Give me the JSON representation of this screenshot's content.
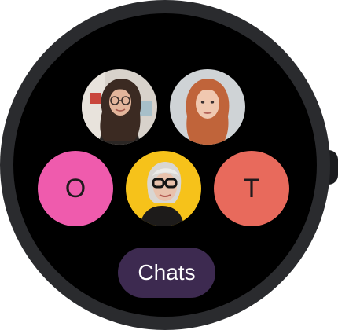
{
  "contacts": [
    {
      "type": "photo",
      "icon": "person-avatar-curly-hair-glasses"
    },
    {
      "type": "photo",
      "icon": "person-avatar-red-hair"
    },
    {
      "type": "letter",
      "initial": "O",
      "color": "#ef5bad"
    },
    {
      "type": "photo",
      "icon": "person-avatar-grey-hair-glasses"
    },
    {
      "type": "letter",
      "initial": "T",
      "color": "#e86a5c"
    }
  ],
  "chats_button": {
    "label": "Chats",
    "color": "#3d2a50"
  }
}
